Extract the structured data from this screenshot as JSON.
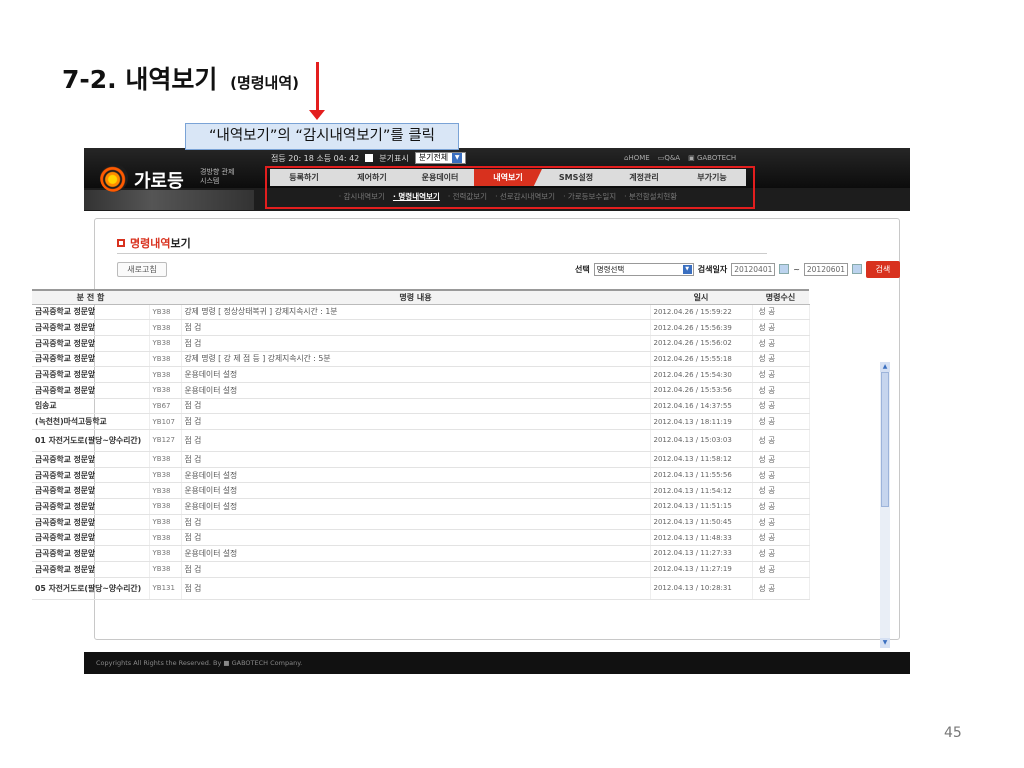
{
  "slide": {
    "title": "7-2. 내역보기",
    "subtitle": "(명령내역)",
    "page_number": "45"
  },
  "header": {
    "logo_name": "가로등",
    "logo_tagline": "경방향 관제시스템",
    "status_text": "점등 20: 18 소등 04: 42",
    "branch_label": "분기표시",
    "branch_select": "분기전체",
    "top_links": [
      "HOME",
      "Q&A",
      "GABOTECH"
    ]
  },
  "main_menu": [
    {
      "label": "등록하기",
      "active": false
    },
    {
      "label": "제어하기",
      "active": false
    },
    {
      "label": "운용데이터",
      "active": false
    },
    {
      "label": "내역보기",
      "active": true
    },
    {
      "label": "SMS설정",
      "active": false
    },
    {
      "label": "계정관리",
      "active": false
    },
    {
      "label": "부가기능",
      "active": false
    }
  ],
  "sub_menu": [
    {
      "label": "· 감시내역보기",
      "active": false
    },
    {
      "label": "· 명령내역보기",
      "active": true
    },
    {
      "label": "· 전력값보기",
      "active": false
    },
    {
      "label": "· 선로감시내역보기",
      "active": false
    },
    {
      "label": "· 가로등보수일지",
      "active": false
    },
    {
      "label": "· 분전함설치현황",
      "active": false
    }
  ],
  "panel": {
    "title_red": "명령내역",
    "title_rest": "보기",
    "refresh_label": "새로고침",
    "select_label": "선택",
    "select_value": "명령선택",
    "date_label": "검색일자",
    "date_from": "20120401",
    "date_sep": "~",
    "date_to": "20120601",
    "search_label": "검색"
  },
  "callout": "“내역보기”의 “감시내역보기”를 클릭",
  "table": {
    "headers": [
      "분 전 함",
      "",
      "명령 내용",
      "일시",
      "명령수신"
    ],
    "rows": [
      [
        "금곡중학교 정문앞",
        "YB38",
        "강제 명령 [ 정상상태복귀 ] 강제지속시간 : 1분",
        "2012.04.26  /  15:59:22",
        "성 공"
      ],
      [
        "금곡중학교 정문앞",
        "YB38",
        "점 검",
        "2012.04.26  /  15:56:39",
        "성 공"
      ],
      [
        "금곡중학교 정문앞",
        "YB38",
        "점 검",
        "2012.04.26  /  15:56:02",
        "성 공"
      ],
      [
        "금곡중학교 정문앞",
        "YB38",
        "강제 명령 [ 강 제   점 등 ] 강제지속시간 : 5분",
        "2012.04.26  /  15:55:18",
        "성 공"
      ],
      [
        "금곡중학교 정문앞",
        "YB38",
        "운용데이터 설정",
        "2012.04.26  /  15:54:30",
        "성 공"
      ],
      [
        "금곡중학교 정문앞",
        "YB38",
        "운용데이터 설정",
        "2012.04.26  /  15:53:56",
        "성 공"
      ],
      [
        "임송교",
        "YB67",
        "점 검",
        "2012.04.16  /  14:37:55",
        "성 공"
      ],
      [
        "(녹천천)마석고등학교",
        "YB107",
        "점 검",
        "2012.04.13  /  18:11:19",
        "성 공"
      ],
      [
        "01 자전거도로(팔당~양수리간)",
        "YB127",
        "점 검",
        "2012.04.13  /  15:03:03",
        "성 공"
      ],
      [
        "금곡중학교 정문앞",
        "YB38",
        "점 검",
        "2012.04.13  /  11:58:12",
        "성 공"
      ],
      [
        "금곡중학교 정문앞",
        "YB38",
        "운용데이터 설정",
        "2012.04.13  /  11:55:56",
        "성 공"
      ],
      [
        "금곡중학교 정문앞",
        "YB38",
        "운용데이터 설정",
        "2012.04.13  /  11:54:12",
        "성 공"
      ],
      [
        "금곡중학교 정문앞",
        "YB38",
        "운용데이터 설정",
        "2012.04.13  /  11:51:15",
        "성 공"
      ],
      [
        "금곡중학교 정문앞",
        "YB38",
        "점 검",
        "2012.04.13  /  11:50:45",
        "성 공"
      ],
      [
        "금곡중학교 정문앞",
        "YB38",
        "점 검",
        "2012.04.13  /  11:48:33",
        "성 공"
      ],
      [
        "금곡중학교 정문앞",
        "YB38",
        "운용데이터 설정",
        "2012.04.13  /  11:27:33",
        "성 공"
      ],
      [
        "금곡중학교 정문앞",
        "YB38",
        "점 검",
        "2012.04.13  /  11:27:19",
        "성 공"
      ],
      [
        "05 자전거도로(팔당~양수리간)",
        "YB131",
        "점 검",
        "2012.04.13  /  10:28:31",
        "성 공"
      ]
    ]
  },
  "footer": "Copyrights All Rights the Reserved. By ■ GABOTECH Company.",
  "colors": {
    "accent": "#d8311e",
    "callout_bg": "#d9e6f6",
    "highlight": "#e31e1e"
  }
}
